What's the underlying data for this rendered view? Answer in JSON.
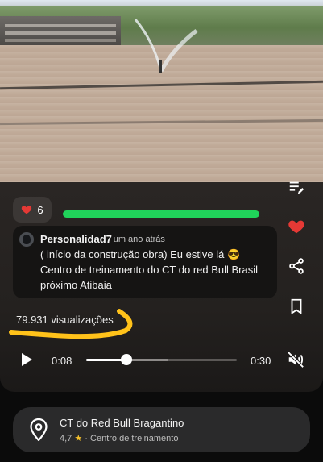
{
  "reaction": {
    "heart_icon": "heart-icon",
    "count": "6",
    "color": "#e53935"
  },
  "comment": {
    "user": "Personalidad7",
    "time": "· um ano atrás",
    "text": "( início da construção obra) Eu estive lá 😎 Centro de treinamento do CT do red Bull Brasil próximo Atibaia"
  },
  "stats": {
    "views": "79.931 visualizações"
  },
  "player": {
    "current_time": "0:08",
    "duration": "0:30",
    "progress": 0.27
  },
  "side_actions": [
    "edit-list-icon",
    "heart-icon",
    "share-icon",
    "bookmark-icon",
    "mute-icon"
  ],
  "place": {
    "title": "CT do Red Bull Bragantino",
    "rating": "4,7",
    "star": "★",
    "category": "· Centro de treinamento"
  },
  "colors": {
    "annotation_green": "#20d35a",
    "annotation_yellow": "#ffc21a"
  }
}
